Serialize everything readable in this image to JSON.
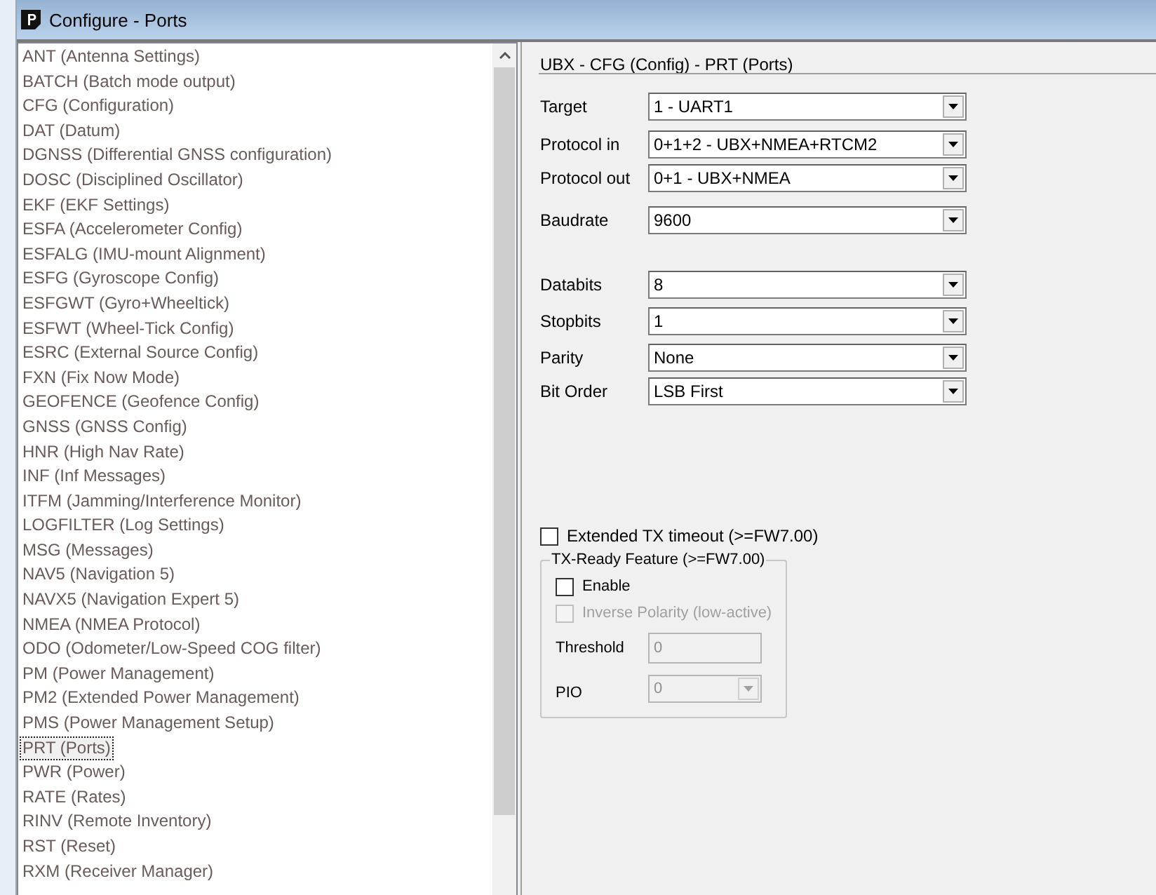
{
  "window": {
    "title": "Configure - Ports"
  },
  "messages": {
    "items": [
      {
        "label": "ANT (Antenna Settings)",
        "selected": false
      },
      {
        "label": "BATCH (Batch mode output)",
        "selected": false
      },
      {
        "label": "CFG (Configuration)",
        "selected": false
      },
      {
        "label": "DAT (Datum)",
        "selected": false
      },
      {
        "label": "DGNSS (Differential GNSS configuration)",
        "selected": false
      },
      {
        "label": "DOSC (Disciplined Oscillator)",
        "selected": false
      },
      {
        "label": "EKF (EKF Settings)",
        "selected": false
      },
      {
        "label": "ESFA (Accelerometer Config)",
        "selected": false
      },
      {
        "label": "ESFALG (IMU-mount Alignment)",
        "selected": false
      },
      {
        "label": "ESFG (Gyroscope Config)",
        "selected": false
      },
      {
        "label": "ESFGWT (Gyro+Wheeltick)",
        "selected": false
      },
      {
        "label": "ESFWT (Wheel-Tick Config)",
        "selected": false
      },
      {
        "label": "ESRC (External Source Config)",
        "selected": false
      },
      {
        "label": "FXN (Fix Now Mode)",
        "selected": false
      },
      {
        "label": "GEOFENCE (Geofence Config)",
        "selected": false
      },
      {
        "label": "GNSS (GNSS Config)",
        "selected": false
      },
      {
        "label": "HNR (High Nav Rate)",
        "selected": false
      },
      {
        "label": "INF (Inf Messages)",
        "selected": false
      },
      {
        "label": "ITFM (Jamming/Interference Monitor)",
        "selected": false
      },
      {
        "label": "LOGFILTER (Log Settings)",
        "selected": false
      },
      {
        "label": "MSG (Messages)",
        "selected": false
      },
      {
        "label": "NAV5 (Navigation 5)",
        "selected": false
      },
      {
        "label": "NAVX5 (Navigation Expert 5)",
        "selected": false
      },
      {
        "label": "NMEA (NMEA Protocol)",
        "selected": false
      },
      {
        "label": "ODO (Odometer/Low-Speed COG filter)",
        "selected": false
      },
      {
        "label": "PM (Power Management)",
        "selected": false
      },
      {
        "label": "PM2 (Extended Power Management)",
        "selected": false
      },
      {
        "label": "PMS (Power Management Setup)",
        "selected": false
      },
      {
        "label": "PRT (Ports)",
        "selected": true
      },
      {
        "label": "PWR (Power)",
        "selected": false
      },
      {
        "label": "RATE (Rates)",
        "selected": false
      },
      {
        "label": "RINV (Remote Inventory)",
        "selected": false
      },
      {
        "label": "RST (Reset)",
        "selected": false
      },
      {
        "label": "RXM (Receiver Manager)",
        "selected": false
      }
    ]
  },
  "panel": {
    "heading": "UBX - CFG (Config) - PRT (Ports)",
    "port_fields": [
      {
        "label": "Target",
        "value": "1 - UART1"
      },
      {
        "label": "Protocol in",
        "value": "0+1+2 - UBX+NMEA+RTCM2"
      },
      {
        "label": "Protocol out",
        "value": "0+1 - UBX+NMEA"
      },
      {
        "label": "Baudrate",
        "value": "9600"
      }
    ],
    "serial_fields": [
      {
        "label": "Databits",
        "value": "8"
      },
      {
        "label": "Stopbits",
        "value": "1"
      },
      {
        "label": "Parity",
        "value": "None"
      },
      {
        "label": "Bit Order",
        "value": "LSB First"
      }
    ],
    "extended_tx_timeout": {
      "label": "Extended TX timeout (>=FW7.00)",
      "checked": false
    },
    "tx_ready": {
      "title": "TX-Ready Feature (>=FW7.00)",
      "enable": {
        "label": "Enable",
        "checked": false
      },
      "inverse_polarity": {
        "label": "Inverse Polarity (low-active)",
        "checked": false,
        "disabled": true
      },
      "threshold": {
        "label": "Threshold",
        "value": "0",
        "disabled": true
      },
      "pio": {
        "label": "PIO",
        "value": "0",
        "disabled": true
      }
    }
  }
}
